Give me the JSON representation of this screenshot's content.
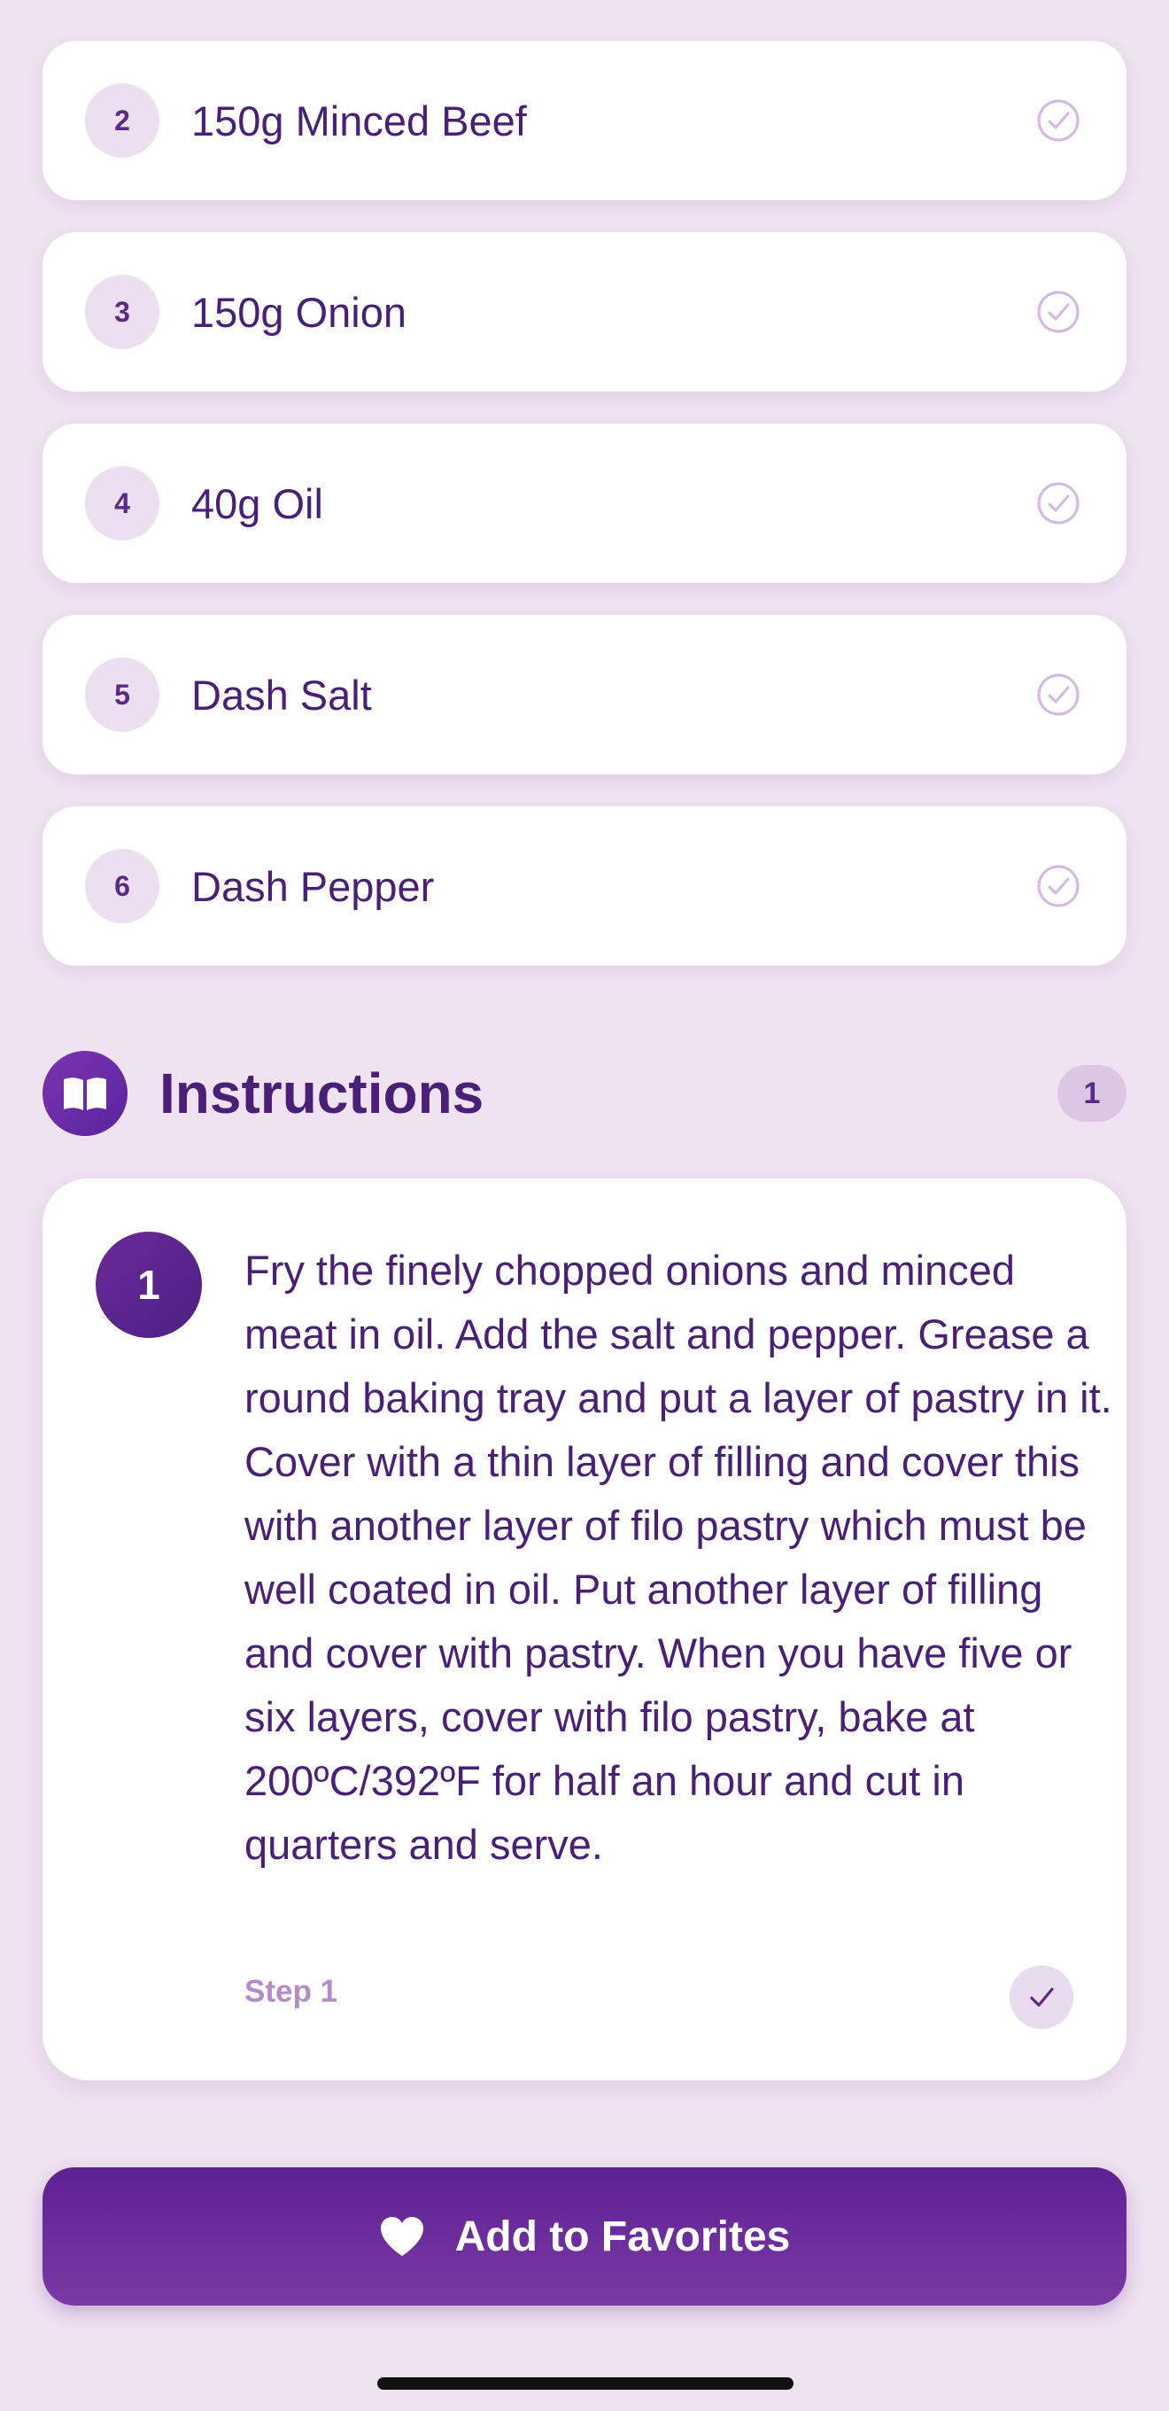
{
  "ingredients": [
    {
      "number": "2",
      "text": "150g Minced Beef"
    },
    {
      "number": "3",
      "text": "150g Onion"
    },
    {
      "number": "4",
      "text": "40g Oil"
    },
    {
      "number": "5",
      "text": "Dash Salt"
    },
    {
      "number": "6",
      "text": "Dash Pepper"
    }
  ],
  "instructions": {
    "title": "Instructions",
    "count": "1",
    "icon": "book-icon",
    "steps": [
      {
        "number": "1",
        "text": "Fry the finely chopped onions and minced meat in oil. Add the salt and pepper. Grease a round baking tray and put a layer of pastry in it. Cover with a thin layer of filling and cover this with another layer of filo pastry which must be well coated in oil. Put another layer of filling and cover with pastry. When you have five or six layers, cover with filo pastry, bake at 200ºC/392ºF for half an hour and cut in quarters and serve.",
        "label": "Step 1"
      }
    ]
  },
  "favorites_button": {
    "label": "Add to Favorites",
    "icon": "heart-icon"
  },
  "colors": {
    "background": "#efe2f1",
    "accent": "#5e2194",
    "text": "#4a1f78"
  }
}
